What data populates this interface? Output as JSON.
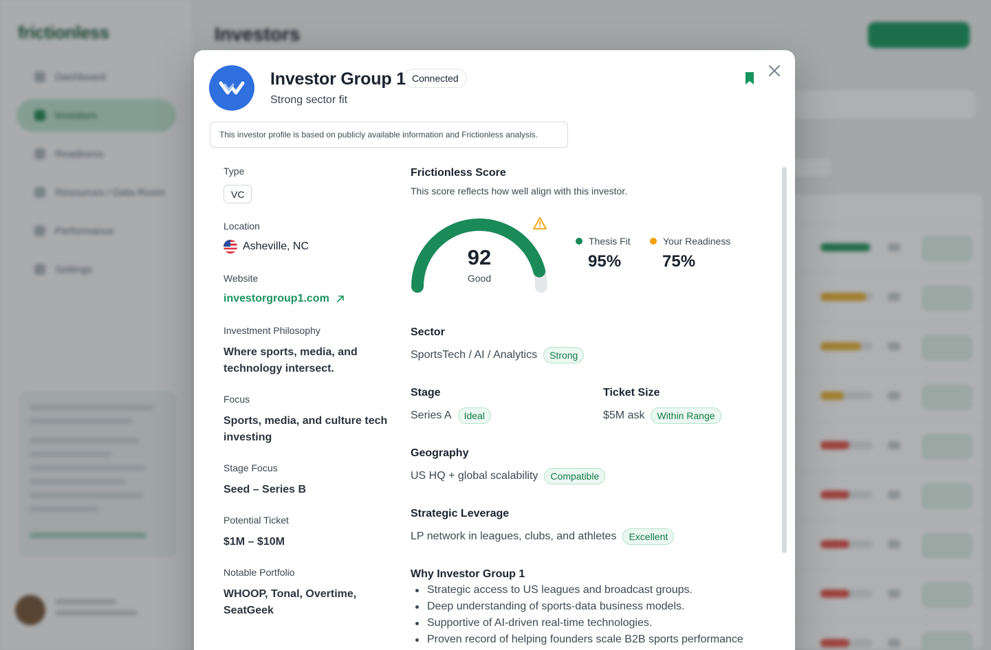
{
  "background": {
    "app_name": "frictionless",
    "page_title": "Investors",
    "nav_items": [
      "Dashboard",
      "Investors",
      "Readiness",
      "Resources / Data Room",
      "Performance",
      "Settings"
    ]
  },
  "modal": {
    "title": "Investor Group 1",
    "connection_badge": "Connected",
    "subtitle": "Strong sector fit",
    "notice": "This investor profile is based on publicly available information and Frictionless analysis.",
    "left": {
      "type_label": "Type",
      "type_value": "VC",
      "location_label": "Location",
      "location_value": "Asheville, NC",
      "website_label": "Website",
      "website_value": "investorgroup1.com",
      "philosophy_label": "Investment Philosophy",
      "philosophy_value": "Where sports, media, and technology intersect.",
      "focus_label": "Focus",
      "focus_value": "Sports, media, and culture tech investing",
      "stage_focus_label": "Stage Focus",
      "stage_focus_value": "Seed – Series B",
      "ticket_label": "Potential Ticket",
      "ticket_value": "$1M – $10M",
      "portfolio_label": "Notable Portfolio",
      "portfolio_value": "WHOOP, Tonal, Overtime, SeatGeek"
    },
    "score": {
      "title": "Frictionless Score",
      "description": "This score reflects how well align with this investor.",
      "value": "92",
      "value_fraction": 0.92,
      "rating": "Good",
      "thesis_fit_label": "Thesis Fit",
      "thesis_fit_value": "95%",
      "readiness_label": "Your Readiness",
      "readiness_value": "75%",
      "thesis_color": "#1a8a59",
      "readiness_color": "#f1a10c"
    },
    "sector": {
      "title": "Sector",
      "value": "SportsTech / AI / Analytics",
      "tag": "Strong"
    },
    "stage": {
      "title": "Stage",
      "value": "Series A",
      "tag": "Ideal"
    },
    "ticket_size": {
      "title": "Ticket Size",
      "value": "$5M ask",
      "tag": "Within Range"
    },
    "geography": {
      "title": "Geography",
      "value": "US HQ + global scalability",
      "tag": "Compatible"
    },
    "leverage": {
      "title": "Strategic Leverage",
      "value": "LP network in leagues, clubs, and athletes",
      "tag": "Excellent"
    },
    "why": {
      "title": "Why Investor Group 1",
      "items": [
        "Strategic access to US leagues and broadcast groups.",
        "Deep understanding of sports-data business models.",
        "Supportive of AI-driven real-time technologies.",
        "Proven record of helping founders scale B2B sports performance"
      ]
    }
  },
  "colors": {
    "accent": "#17935c",
    "gauge_track": "#e4e7ea",
    "warning": "#f1a10c"
  }
}
